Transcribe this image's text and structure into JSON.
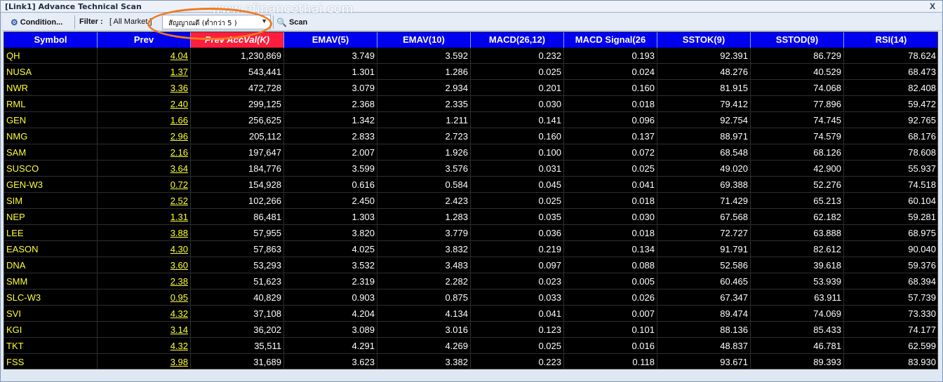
{
  "window": {
    "title": "[Link1] Advance Technical Scan",
    "close_glyph": "X"
  },
  "watermark": "www.efinancethai.com",
  "toolbar": {
    "condition_label": "Condition...",
    "filter_label": "Filter :",
    "filter_value": "[ All Market ]",
    "signal_select_value": "สัญญาณดี (ต่ำกว่า 5 )",
    "scan_label": "Scan"
  },
  "columns": [
    {
      "label": "Symbol"
    },
    {
      "label": "Prev"
    },
    {
      "label": "Prev AccVal(K)",
      "sorted": true
    },
    {
      "label": "EMAV(5)"
    },
    {
      "label": "EMAV(10)"
    },
    {
      "label": "MACD(26,12)"
    },
    {
      "label": "MACD Signal(26"
    },
    {
      "label": "SSTOK(9)"
    },
    {
      "label": "SSTOD(9)"
    },
    {
      "label": "RSI(14)"
    }
  ],
  "rows": [
    [
      "QH",
      "4.04",
      "1,230,869",
      "3.749",
      "3.592",
      "0.232",
      "0.193",
      "92.391",
      "86.729",
      "78.624"
    ],
    [
      "NUSA",
      "1.37",
      "543,441",
      "1.301",
      "1.286",
      "0.025",
      "0.024",
      "48.276",
      "40.529",
      "68.473"
    ],
    [
      "NWR",
      "3.36",
      "472,728",
      "3.079",
      "2.934",
      "0.201",
      "0.160",
      "81.915",
      "74.068",
      "82.408"
    ],
    [
      "RML",
      "2.40",
      "299,125",
      "2.368",
      "2.335",
      "0.030",
      "0.018",
      "79.412",
      "77.896",
      "59.472"
    ],
    [
      "GEN",
      "1.66",
      "256,625",
      "1.342",
      "1.211",
      "0.141",
      "0.096",
      "92.754",
      "74.745",
      "92.765"
    ],
    [
      "NMG",
      "2.96",
      "205,112",
      "2.833",
      "2.723",
      "0.160",
      "0.137",
      "88.971",
      "74.579",
      "68.176"
    ],
    [
      "SAM",
      "2.16",
      "197,647",
      "2.007",
      "1.926",
      "0.100",
      "0.072",
      "68.548",
      "68.126",
      "78.608"
    ],
    [
      "SUSCO",
      "3.64",
      "184,776",
      "3.599",
      "3.576",
      "0.031",
      "0.025",
      "49.020",
      "42.900",
      "55.937"
    ],
    [
      "GEN-W3",
      "0.72",
      "154,928",
      "0.616",
      "0.584",
      "0.045",
      "0.041",
      "69.388",
      "52.276",
      "74.518"
    ],
    [
      "SIM",
      "2.52",
      "102,266",
      "2.450",
      "2.423",
      "0.025",
      "0.018",
      "71.429",
      "65.213",
      "60.104"
    ],
    [
      "NEP",
      "1.31",
      "86,481",
      "1.303",
      "1.283",
      "0.035",
      "0.030",
      "67.568",
      "62.182",
      "59.281"
    ],
    [
      "LEE",
      "3.88",
      "57,955",
      "3.820",
      "3.779",
      "0.036",
      "0.018",
      "72.727",
      "63.888",
      "68.975"
    ],
    [
      "EASON",
      "4.30",
      "57,863",
      "4.025",
      "3.832",
      "0.219",
      "0.134",
      "91.791",
      "82.612",
      "90.040"
    ],
    [
      "DNA",
      "3.60",
      "53,293",
      "3.532",
      "3.483",
      "0.097",
      "0.088",
      "52.586",
      "39.618",
      "59.376"
    ],
    [
      "SMM",
      "2.38",
      "51,623",
      "2.319",
      "2.282",
      "0.023",
      "0.005",
      "60.465",
      "53.939",
      "68.394"
    ],
    [
      "SLC-W3",
      "0.95",
      "40,829",
      "0.903",
      "0.875",
      "0.033",
      "0.026",
      "67.347",
      "63.911",
      "57.739"
    ],
    [
      "SVI",
      "4.32",
      "37,108",
      "4.204",
      "4.134",
      "0.041",
      "0.007",
      "89.474",
      "74.069",
      "73.330"
    ],
    [
      "KGI",
      "3.14",
      "36,202",
      "3.089",
      "3.016",
      "0.123",
      "0.101",
      "88.136",
      "85.433",
      "74.177"
    ],
    [
      "TKT",
      "4.32",
      "35,511",
      "4.291",
      "4.269",
      "0.025",
      "0.016",
      "48.837",
      "46.781",
      "62.599"
    ],
    [
      "FSS",
      "3.98",
      "31,689",
      "3.623",
      "3.382",
      "0.223",
      "0.118",
      "93.671",
      "89.393",
      "83.930"
    ]
  ],
  "colors": {
    "header_bg": "#0000ee",
    "sorted_header_bg": "#ff1e3c",
    "grid_bg": "#000000",
    "symbol_text": "#ffff33",
    "value_text": "#ffffff",
    "highlight_ring": "#f07a1e"
  }
}
